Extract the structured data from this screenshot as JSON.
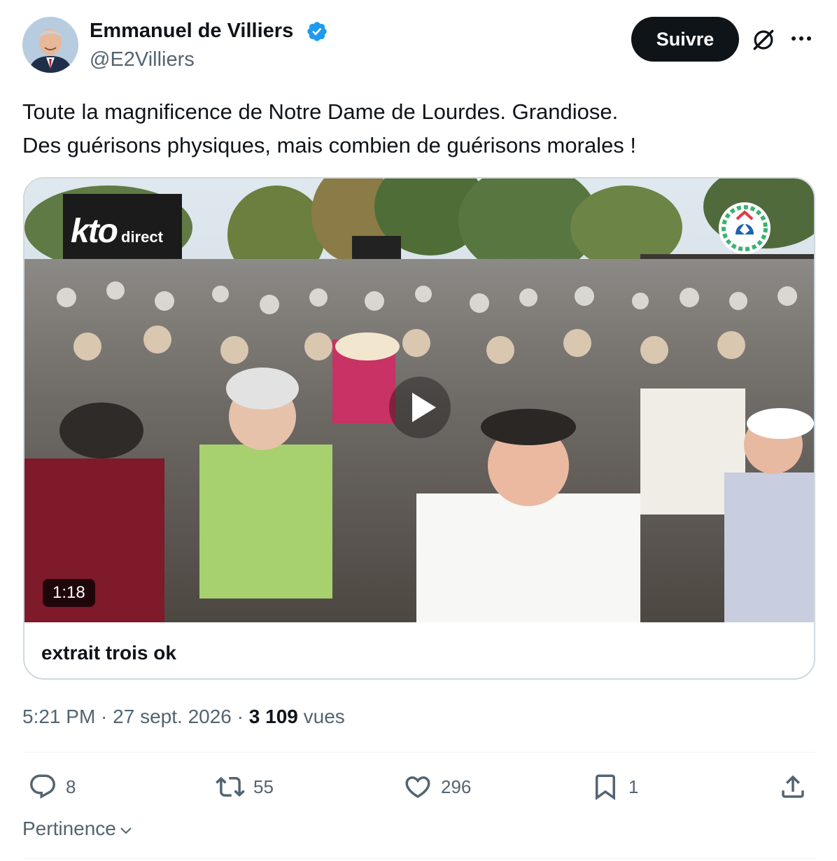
{
  "author": {
    "name": "Emmanuel de Villiers",
    "handle": "@E2Villiers",
    "verified": true,
    "verified_color": "#1d9bf0"
  },
  "header_actions": {
    "follow_label": "Suivre",
    "grok_icon": "grok-icon",
    "more_icon": "more-icon"
  },
  "tweet": {
    "lines": [
      "Toute la magnificence de Notre Dame de Lourdes. Grandiose.",
      "Des guérisons physiques, mais combien de guérisons morales !"
    ]
  },
  "media": {
    "overlay_brand": "kto",
    "overlay_brand_suffix": "direct",
    "duration": "1:18",
    "title": "extrait trois ok",
    "play_icon": "play-icon"
  },
  "meta": {
    "time": "5:21 PM",
    "separator": " · ",
    "date": "27 sept. 2026",
    "views_count": "3 109",
    "views_label": "vues"
  },
  "actions": {
    "replies": "8",
    "reposts": "55",
    "likes": "296",
    "bookmarks": "1"
  },
  "sort": {
    "label": "Pertinence"
  },
  "colors": {
    "text": "#0f1419",
    "secondary": "#536471",
    "border": "#cfd9de",
    "follow_bg": "#0f1419"
  }
}
